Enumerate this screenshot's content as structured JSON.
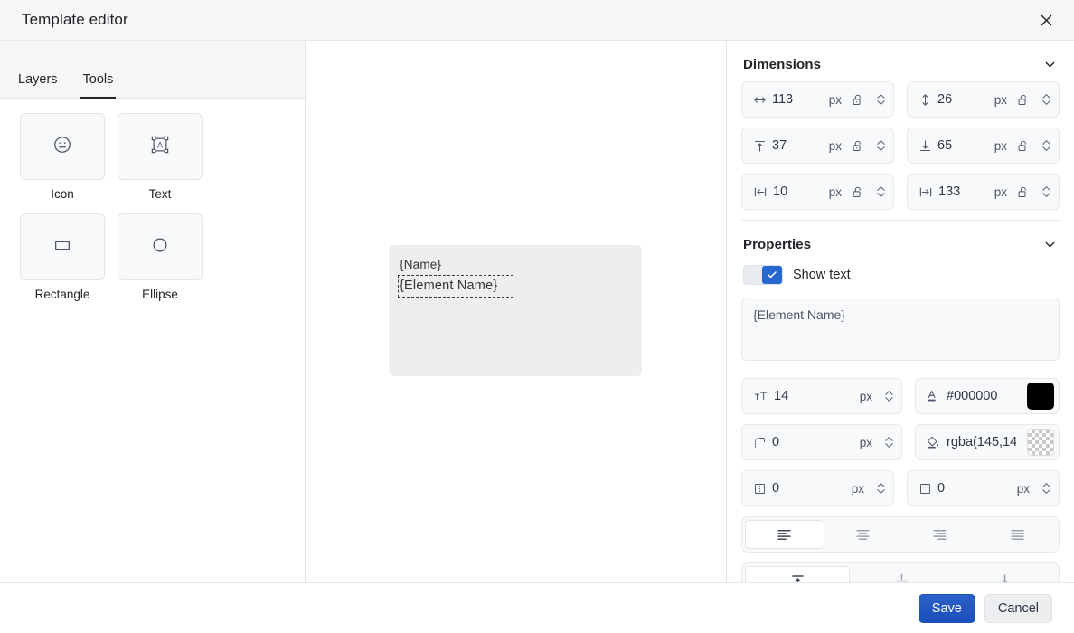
{
  "header": {
    "title": "Template editor",
    "close_icon": "close-icon"
  },
  "sidebar": {
    "tabs": [
      {
        "label": "Layers",
        "active": false
      },
      {
        "label": "Tools",
        "active": true
      }
    ],
    "tools": [
      {
        "label": "Icon",
        "icon": "smiley-face-icon"
      },
      {
        "label": "Text",
        "icon": "text-box-icon"
      },
      {
        "label": "Rectangle",
        "icon": "rectangle-icon"
      },
      {
        "label": "Ellipse",
        "icon": "ellipse-icon"
      }
    ]
  },
  "canvas": {
    "card_text": "{Name}",
    "selected_element_text": "{Element Name}"
  },
  "dimensions": {
    "title": "Dimensions",
    "collapse_icon": "chevron-down-icon",
    "fields": [
      {
        "name": "width",
        "icon": "width-arrow-icon",
        "value": "113",
        "unit": "px",
        "lock": "unlocked-padlock-icon"
      },
      {
        "name": "height",
        "icon": "height-arrow-icon",
        "value": "26",
        "unit": "px",
        "lock": "unlocked-padlock-icon"
      },
      {
        "name": "top",
        "icon": "align-top-icon",
        "value": "37",
        "unit": "px",
        "lock": "unlocked-padlock-icon"
      },
      {
        "name": "bottom",
        "icon": "align-bottom-icon",
        "value": "65",
        "unit": "px",
        "lock": "unlocked-padlock-icon"
      },
      {
        "name": "left",
        "icon": "align-left-edge-icon",
        "value": "10",
        "unit": "px",
        "lock": "unlocked-padlock-icon"
      },
      {
        "name": "right",
        "icon": "align-right-edge-icon",
        "value": "133",
        "unit": "px",
        "lock": "unlocked-padlock-icon"
      }
    ]
  },
  "properties": {
    "title": "Properties",
    "collapse_icon": "chevron-down-icon",
    "show_text": {
      "label": "Show text",
      "checked": true
    },
    "text_value": "{Element Name}",
    "font_size": {
      "icon": "font-size-icon",
      "value": "14",
      "unit": "px"
    },
    "text_color": {
      "icon": "text-color-icon",
      "value": "#000000",
      "swatch": "#000000"
    },
    "border_radius": {
      "icon": "border-radius-icon",
      "value": "0",
      "unit": "px"
    },
    "fill_color": {
      "icon": "paint-bucket-icon",
      "value": "rgba(145,14",
      "swatch": "transparent"
    },
    "padding_x": {
      "icon": "padding-horizontal-icon",
      "value": "0",
      "unit": "px"
    },
    "padding_y": {
      "icon": "padding-vertical-icon",
      "value": "0",
      "unit": "px"
    },
    "text_align": {
      "options": [
        "align-left-icon",
        "align-center-icon",
        "align-right-icon",
        "align-justify-icon"
      ],
      "selected": 0
    },
    "vertical_align": {
      "options": [
        "valign-top-icon",
        "valign-middle-icon",
        "valign-bottom-icon"
      ],
      "selected": 0
    }
  },
  "footer": {
    "save_label": "Save",
    "cancel_label": "Cancel",
    "save_color": "#2558c0"
  }
}
